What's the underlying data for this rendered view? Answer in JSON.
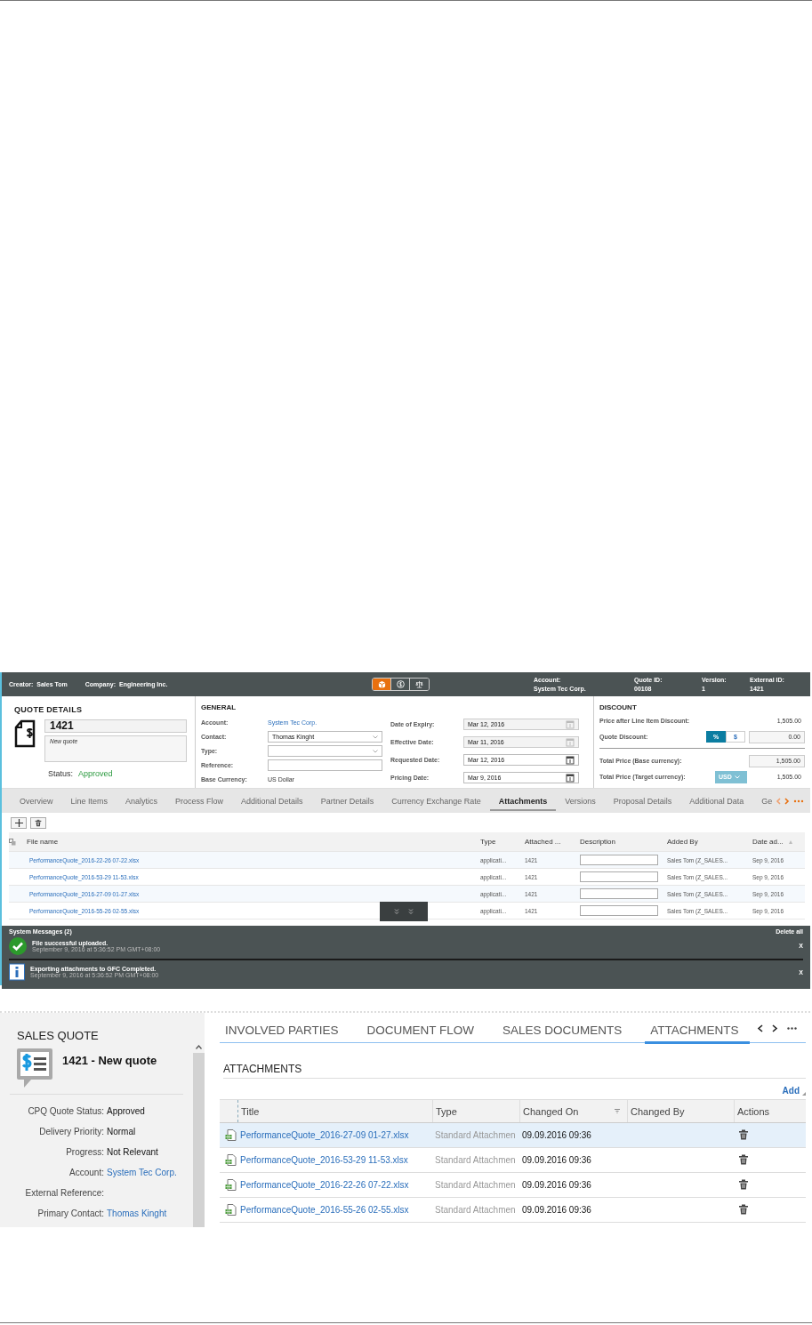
{
  "cpq": {
    "header": {
      "creator_label": "Creator:",
      "creator": "Sales Tom",
      "company_label": "Company:",
      "company": "Engineering Inc.",
      "view_buttons": [
        {
          "kind": "product",
          "selected": true
        },
        {
          "kind": "price",
          "selected": false
        },
        {
          "kind": "balance",
          "selected": false
        }
      ],
      "fields": [
        {
          "label": "Account:",
          "value": "System Tec Corp."
        },
        {
          "label": "Quote ID:",
          "value": "00108"
        },
        {
          "label": "Version:",
          "value": "1"
        },
        {
          "label": "External ID:",
          "value": "1421"
        }
      ]
    },
    "quote_details": {
      "title": "QUOTE DETAILS",
      "number": "1421",
      "description": "New quote",
      "status_label": "Status:",
      "status": "Approved"
    },
    "general": {
      "title": "GENERAL",
      "left": [
        {
          "label": "Account:",
          "kind": "link",
          "value": "System Tec Corp."
        },
        {
          "label": "Contact:",
          "kind": "select",
          "value": "Thomas Kinght"
        },
        {
          "label": "Type:",
          "kind": "select"
        },
        {
          "label": "Reference:",
          "kind": "input"
        },
        {
          "label": "Base Currency:",
          "kind": "text",
          "value": "US Dollar"
        }
      ],
      "right": [
        {
          "label": "Date of Expiry:",
          "value": "Mar 12, 2016",
          "disabled": true
        },
        {
          "label": "Effective Date:",
          "value": "Mar 11, 2016",
          "disabled": true
        },
        {
          "label": "Requested Date:",
          "value": "Mar 12, 2016",
          "disabled": false
        },
        {
          "label": "Pricing Date:",
          "value": "Mar 9, 2016",
          "disabled": false
        }
      ]
    },
    "discount": {
      "title": "DISCOUNT",
      "price_after_label": "Price after Line Item Discount:",
      "price_after": "1,505.00",
      "quote_discount_label": "Quote Discount:",
      "modes": [
        {
          "label": "%",
          "selected": true
        },
        {
          "label": "$",
          "selected": false
        }
      ],
      "quote_discount": "0.00",
      "total_base_label": "Total Price (Base currency):",
      "total_base": "1,505.00",
      "total_target_label": "Total Price (Target currency):",
      "currency": "USD",
      "total_target": "1,505.00"
    },
    "tabs": [
      {
        "label": "Overview",
        "selected": false
      },
      {
        "label": "Line Items",
        "selected": false
      },
      {
        "label": "Analytics",
        "selected": false
      },
      {
        "label": "Process Flow",
        "selected": false
      },
      {
        "label": "Additional Details",
        "selected": false
      },
      {
        "label": "Partner Details",
        "selected": false
      },
      {
        "label": "Currency Exchange Rate",
        "selected": false
      },
      {
        "label": "Attachments",
        "selected": true
      },
      {
        "label": "Versions",
        "selected": false
      },
      {
        "label": "Proposal Details",
        "selected": false
      },
      {
        "label": "Additional Data",
        "selected": false
      },
      {
        "label": "Ge",
        "selected": false
      }
    ],
    "table": {
      "columns": [
        "File name",
        "Type",
        "Attached ...",
        "Description",
        "Added By",
        "Date ad..."
      ],
      "rows": [
        {
          "name": "PerformanceQuote_2016-22-26 07-22.xlsx",
          "type": "applicati...",
          "attached": "1421",
          "added_by": "Sales Tom (Z_SALES...",
          "date": "Sep 9, 2016"
        },
        {
          "name": "PerformanceQuote_2016-53-29 11-53.xlsx",
          "type": "applicati...",
          "attached": "1421",
          "added_by": "Sales Tom (Z_SALES...",
          "date": "Sep 9, 2016"
        },
        {
          "name": "PerformanceQuote_2016-27-09 01-27.xlsx",
          "type": "applicati...",
          "attached": "1421",
          "added_by": "Sales Tom (Z_SALES...",
          "date": "Sep 9, 2016"
        },
        {
          "name": "PerformanceQuote_2016-55-26 02-55.xlsx",
          "type": "applicati...",
          "attached": "1421",
          "added_by": "Sales Tom (Z_SALES...",
          "date": "Sep 9, 2016"
        }
      ]
    },
    "messages": {
      "title": "System Messages (2)",
      "delete_all": "Delete all",
      "items": [
        {
          "kind": "success",
          "text": "File successful uploaded.",
          "time": "September 9, 2016 at 5:36:52 PM GMT+08:00",
          "close": "X"
        },
        {
          "kind": "info",
          "text": "Exporting attachments to GFC Completed.",
          "time": "September 9, 2016 at 5:36:52 PM GMT+08:00",
          "close": "X"
        }
      ]
    }
  },
  "c4c": {
    "sidebar": {
      "title": "SALES QUOTE",
      "quote": "1421 - New quote",
      "fields": [
        {
          "label": "CPQ Quote Status:",
          "kind": "text",
          "value": "Approved"
        },
        {
          "label": "Delivery Priority:",
          "kind": "text",
          "value": "Normal"
        },
        {
          "label": "Progress:",
          "kind": "text",
          "value": "Not Relevant"
        },
        {
          "label": "Account:",
          "kind": "link",
          "value": "System Tec Corp."
        },
        {
          "label": "External Reference:",
          "kind": "text"
        },
        {
          "label": "Primary Contact:",
          "kind": "link",
          "value": "Thomas Kinght"
        }
      ]
    },
    "tabs": [
      {
        "label": "INVOLVED PARTIES",
        "selected": false
      },
      {
        "label": "DOCUMENT FLOW",
        "selected": false
      },
      {
        "label": "SALES DOCUMENTS",
        "selected": false
      },
      {
        "label": "ATTACHMENTS",
        "selected": true
      }
    ],
    "section_title": "ATTACHMENTS",
    "add": "Add",
    "table": {
      "columns": [
        "Title",
        "Type",
        "Changed On",
        "Changed By",
        "Actions"
      ],
      "rows": [
        {
          "title": "PerformanceQuote_2016-27-09 01-27.xlsx",
          "type": "Standard Attachmen",
          "changed_on": "09.09.2016 09:36",
          "selected": true
        },
        {
          "title": "PerformanceQuote_2016-53-29 11-53.xlsx",
          "type": "Standard Attachmen",
          "changed_on": "09.09.2016 09:36",
          "selected": false
        },
        {
          "title": "PerformanceQuote_2016-22-26 07-22.xlsx",
          "type": "Standard Attachmen",
          "changed_on": "09.09.2016 09:36",
          "selected": false
        },
        {
          "title": "PerformanceQuote_2016-55-26 02-55.xlsx",
          "type": "Standard Attachmen",
          "changed_on": "09.09.2016 09:36",
          "selected": false
        }
      ]
    }
  }
}
